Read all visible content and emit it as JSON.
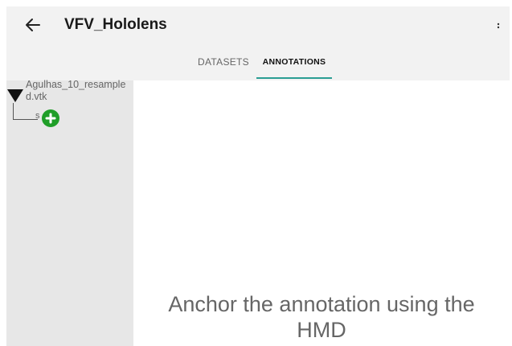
{
  "appbar": {
    "title": "VFV_Hololens",
    "back_icon": "arrow-left-icon",
    "overflow_icon": "more-vert-icon"
  },
  "tabs": {
    "items": [
      {
        "label": "DATASETS",
        "selected": false
      },
      {
        "label": "ANNOTATIONS",
        "selected": true
      }
    ],
    "indicator_color": "#2a9d93"
  },
  "sidebar": {
    "dataset_label": "Agulhas_10_resampled.vtk",
    "child_label": "s",
    "expand_icon": "triangle-down-icon",
    "add_icon": "plus-circle-icon",
    "add_color": "#1f9e28"
  },
  "main": {
    "message": "Anchor the annotation using the HMD"
  }
}
